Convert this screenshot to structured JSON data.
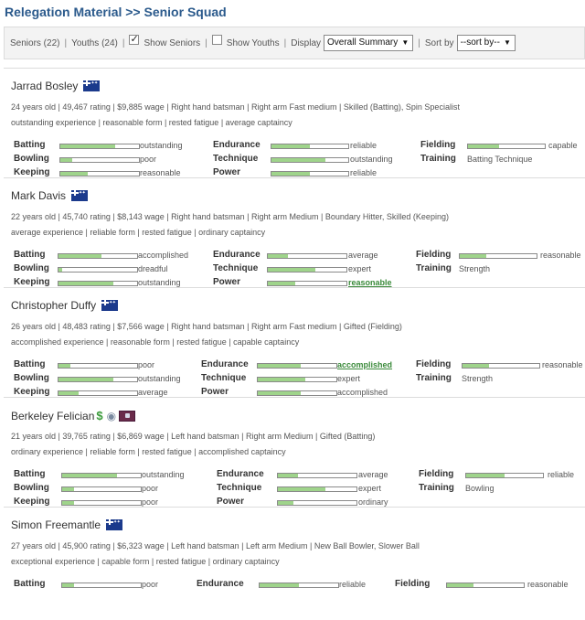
{
  "page": {
    "title": "Relegation Material >> Senior Squad"
  },
  "filters": {
    "seniors": "Seniors (22)",
    "youths": "Youths (24)",
    "show_seniors": "Show Seniors",
    "show_youths": "Show Youths",
    "show_seniors_checked": true,
    "show_youths_checked": false,
    "display_label": "Display",
    "display_value": "Overall Summary",
    "sortby_label": "Sort by",
    "sortby_value": "--sort by--"
  },
  "players": [
    {
      "name": "Jarrad Bosley",
      "info1": "24 years old  |  49,467 rating  |  $9,885 wage  |  Right hand batsman  |  Right arm Fast medium  |  Skilled (Batting), Spin Specialist",
      "info2": "outstanding experience  |  reasonable form  |  rested fatigue  |  average captaincy",
      "skills": {
        "batting": {
          "label": "Batting",
          "value": "outstanding",
          "level": 0.7
        },
        "bowling": {
          "label": "Bowling",
          "value": "poor",
          "level": 0.15
        },
        "keeping": {
          "label": "Keeping",
          "value": "reasonable",
          "level": 0.35
        },
        "endurance": {
          "label": "Endurance",
          "value": "reliable",
          "level": 0.5
        },
        "technique": {
          "label": "Technique",
          "value": "outstanding",
          "level": 0.7
        },
        "power": {
          "label": "Power",
          "value": "reliable",
          "level": 0.5
        },
        "fielding": {
          "label": "Fielding",
          "value": "capable",
          "level": 0.4
        },
        "training": {
          "label": "Training",
          "value": "Batting Technique"
        }
      }
    },
    {
      "name": "Mark Davis",
      "info1": "22 years old  |  45,740 rating  |  $8,143 wage  |  Right hand batsman  |  Right arm Medium  |  Boundary Hitter, Skilled (Keeping)",
      "info2": "average experience  |  reliable form  |  rested fatigue  |  ordinary captaincy",
      "skills": {
        "batting": {
          "label": "Batting",
          "value": "accomplished",
          "level": 0.55
        },
        "bowling": {
          "label": "Bowling",
          "value": "dreadful",
          "level": 0.05
        },
        "keeping": {
          "label": "Keeping",
          "value": "outstanding",
          "level": 0.7
        },
        "endurance": {
          "label": "Endurance",
          "value": "average",
          "level": 0.25
        },
        "technique": {
          "label": "Technique",
          "value": "expert",
          "level": 0.6
        },
        "power": {
          "label": "Power",
          "value": "reasonable",
          "level": 0.35
        },
        "fielding": {
          "label": "Fielding",
          "value": "reasonable",
          "level": 0.35
        },
        "training": {
          "label": "Training",
          "value": "Strength"
        }
      }
    },
    {
      "name": "Christopher Duffy",
      "info1": "26 years old  |  48,483 rating  |  $7,566 wage  |  Right hand batsman  |  Right arm Fast medium  |  Gifted (Fielding)",
      "info2": "accomplished experience  |  reasonable form  |  rested fatigue  |  capable captaincy",
      "skills": {
        "batting": {
          "label": "Batting",
          "value": "poor",
          "level": 0.15
        },
        "bowling": {
          "label": "Bowling",
          "value": "outstanding",
          "level": 0.7
        },
        "keeping": {
          "label": "Keeping",
          "value": "average",
          "level": 0.25
        },
        "endurance": {
          "label": "Endurance",
          "value": "accomplished",
          "level": 0.55
        },
        "technique": {
          "label": "Technique",
          "value": "expert",
          "level": 0.6
        },
        "power": {
          "label": "Power",
          "value": "accomplished",
          "level": 0.55
        },
        "fielding": {
          "label": "Fielding",
          "value": "reasonable",
          "level": 0.35
        },
        "training": {
          "label": "Training",
          "value": "Strength"
        }
      }
    },
    {
      "name": "Berkeley Felician",
      "info1": "21 years old  |  39,765 rating  |  $6,869 wage  |  Left hand batsman  |  Right arm Medium  |  Gifted (Batting)",
      "info2": "ordinary experience  |  reliable form  |  rested fatigue  |  accomplished captaincy",
      "skills": {
        "batting": {
          "label": "Batting",
          "value": "outstanding",
          "level": 0.7
        },
        "bowling": {
          "label": "Bowling",
          "value": "poor",
          "level": 0.15
        },
        "keeping": {
          "label": "Keeping",
          "value": "poor",
          "level": 0.15
        },
        "endurance": {
          "label": "Endurance",
          "value": "average",
          "level": 0.25
        },
        "technique": {
          "label": "Technique",
          "value": "expert",
          "level": 0.6
        },
        "power": {
          "label": "Power",
          "value": "ordinary",
          "level": 0.2
        },
        "fielding": {
          "label": "Fielding",
          "value": "reliable",
          "level": 0.5
        },
        "training": {
          "label": "Training",
          "value": "Bowling"
        }
      }
    },
    {
      "name": "Simon Freemantle",
      "info1": "27 years old  |  45,900 rating  |  $6,323 wage  |  Left hand batsman  |  Left arm Medium  |  New Ball Bowler, Slower Ball",
      "info2": "exceptional experience  |  capable form  |  rested fatigue  |  ordinary captaincy",
      "skills": {
        "batting": {
          "label": "Batting",
          "value": "poor",
          "level": 0.15
        },
        "endurance": {
          "label": "Endurance",
          "value": "reliable",
          "level": 0.5
        },
        "fielding": {
          "label": "Fielding",
          "value": "reasonable",
          "level": 0.35
        }
      }
    }
  ]
}
